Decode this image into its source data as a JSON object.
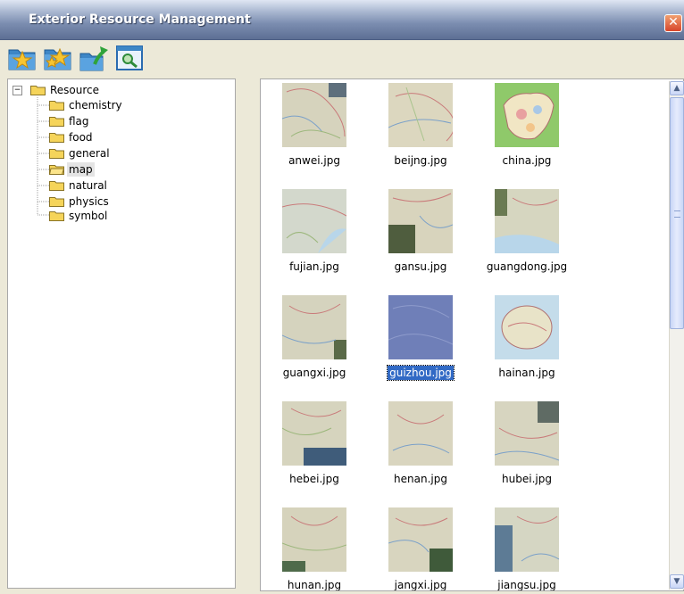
{
  "window": {
    "title": "Exterior Resource Management",
    "close_glyph": "✕"
  },
  "toolbar": {
    "buttons": [
      {
        "name": "new-folder-star-button",
        "icon": "folder-star-icon"
      },
      {
        "name": "add-favorite-button",
        "icon": "folder-stars-icon"
      },
      {
        "name": "upload-folder-button",
        "icon": "folder-up-arrow-icon"
      },
      {
        "name": "search-resource-button",
        "icon": "magnifier-window-icon"
      }
    ]
  },
  "tree": {
    "root": {
      "label": "Resource",
      "expander": "−"
    },
    "children": [
      "chemistry",
      "flag",
      "food",
      "general",
      "map",
      "natural",
      "physics",
      "symbol"
    ],
    "selected": "map"
  },
  "files": [
    {
      "name": "anwei.jpg"
    },
    {
      "name": "beijng.jpg"
    },
    {
      "name": "china.jpg"
    },
    {
      "name": "fujian.jpg"
    },
    {
      "name": "gansu.jpg"
    },
    {
      "name": "guangdong.jpg"
    },
    {
      "name": "guangxi.jpg"
    },
    {
      "name": "guizhou.jpg"
    },
    {
      "name": "hainan.jpg"
    },
    {
      "name": "hebei.jpg"
    },
    {
      "name": "henan.jpg"
    },
    {
      "name": "hubei.jpg"
    },
    {
      "name": "hunan.jpg"
    },
    {
      "name": "jangxi.jpg"
    },
    {
      "name": "jiangsu.jpg"
    }
  ],
  "selected_file": "guizhou.jpg",
  "colors": {
    "selection": "#316AC5",
    "folder": "#F5D45A",
    "map_base": "#d9d6c4"
  }
}
